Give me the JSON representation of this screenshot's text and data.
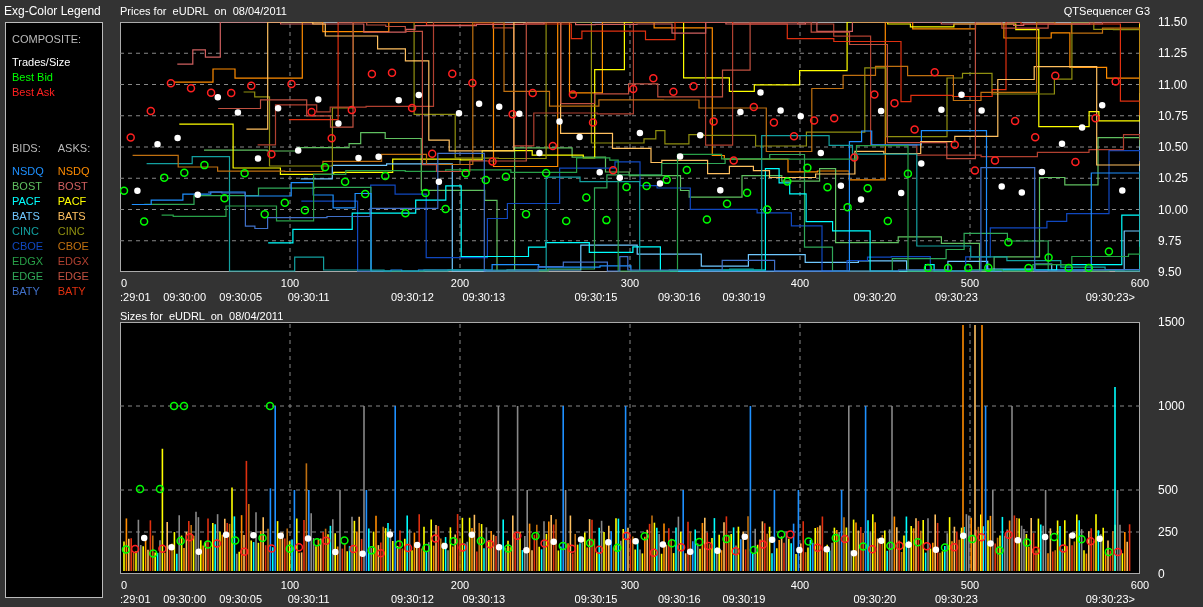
{
  "legend": {
    "title": "Exg-Color Legend",
    "composite_heading": "COMPOSITE:",
    "composite": [
      {
        "label": "Trades/Size",
        "color": "#ffffff"
      },
      {
        "label": "Best Bid",
        "color": "#00ff00"
      },
      {
        "label": "Best Ask",
        "color": "#ff2020"
      }
    ],
    "bids_heading": "BIDS:",
    "asks_heading": "ASKS:",
    "bids": [
      {
        "label": "NSDQ",
        "color": "#1e90ff"
      },
      {
        "label": "BOST",
        "color": "#60c060"
      },
      {
        "label": "PACF",
        "color": "#00ffff"
      },
      {
        "label": "BATS",
        "color": "#70c8ff"
      },
      {
        "label": "CINC",
        "color": "#13a0a0"
      },
      {
        "label": "CBOE",
        "color": "#1048c0"
      },
      {
        "label": "EDGX",
        "color": "#28a048"
      },
      {
        "label": "EDGE",
        "color": "#30a858"
      },
      {
        "label": "BATY",
        "color": "#4070c8"
      }
    ],
    "asks": [
      {
        "label": "NSDQ",
        "color": "#ff8c00"
      },
      {
        "label": "BOST",
        "color": "#d06060"
      },
      {
        "label": "PACF",
        "color": "#ffff00"
      },
      {
        "label": "BATS",
        "color": "#ffc060"
      },
      {
        "label": "CINC",
        "color": "#909010"
      },
      {
        "label": "CBOE",
        "color": "#c07010"
      },
      {
        "label": "EDGX",
        "color": "#b04030"
      },
      {
        "label": "EDGE",
        "color": "#c05040"
      },
      {
        "label": "BATY",
        "color": "#e03010"
      }
    ]
  },
  "app_name": "QTSequencer G3",
  "charts": [
    {
      "kind": "prices",
      "title": "Prices for  eUDRL  on  08/04/2011",
      "y_labels": [
        "11.50",
        "11.25",
        "11.00",
        "10.75",
        "10.50",
        "10.25",
        "10.00",
        "9.75",
        "9.50"
      ],
      "x_labels": [
        "0",
        "100",
        "200",
        "300",
        "400",
        "500",
        "600"
      ],
      "time_labels": [
        ":29:01",
        "09:30:00",
        "09:30:05",
        "09:30:11",
        "09:30:12",
        "09:30:13",
        "09:30:15",
        "09:30:16",
        "09:30:19",
        "09:30:20",
        "09:30:23",
        "09:30:23>"
      ]
    },
    {
      "kind": "sizes",
      "title": "Sizes for  eUDRL  on  08/04/2011",
      "y_labels": [
        "1500",
        "1000",
        "500",
        "250",
        "0"
      ],
      "x_labels": [
        "0",
        "100",
        "200",
        "300",
        "400",
        "500",
        "600"
      ],
      "time_labels": [
        ":29:01",
        "09:30:00",
        "09:30:05",
        "09:30:11",
        "09:30:12",
        "09:30:13",
        "09:30:15",
        "09:30:16",
        "09:30:19",
        "09:30:20",
        "09:30:23",
        "09:30:23>"
      ]
    }
  ]
}
